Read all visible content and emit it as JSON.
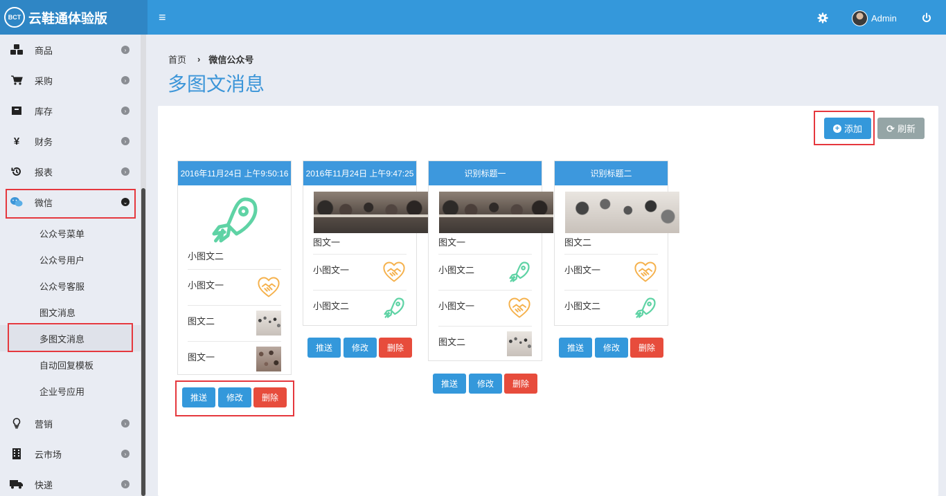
{
  "app": {
    "logo_text": "BCT",
    "title": "云鞋通体验版",
    "user_name": "Admin"
  },
  "sidebar": {
    "items": [
      {
        "label": "商品",
        "icon": "cubes-icon"
      },
      {
        "label": "采购",
        "icon": "cart-icon"
      },
      {
        "label": "库存",
        "icon": "archive-icon"
      },
      {
        "label": "财务",
        "icon": "yen-icon"
      },
      {
        "label": "报表",
        "icon": "history-icon"
      },
      {
        "label": "微信",
        "icon": "wechat-icon"
      },
      {
        "label": "营销",
        "icon": "lightbulb-icon"
      },
      {
        "label": "云市场",
        "icon": "building-icon"
      },
      {
        "label": "快递",
        "icon": "truck-icon"
      }
    ],
    "wechat_sub": [
      "公众号菜单",
      "公众号用户",
      "公众号客服",
      "图文消息",
      "多图文消息",
      "自动回复模板",
      "企业号应用"
    ]
  },
  "breadcrumb": {
    "home": "首页",
    "current": "微信公众号"
  },
  "page_title": "多图文消息",
  "toolbar": {
    "add_label": "添加",
    "refresh_label": "刷新"
  },
  "actions": {
    "push": "推送",
    "edit": "修改",
    "delete": "删除"
  },
  "cards": [
    {
      "header": "2016年11月24日 上午9:50:16",
      "cover_title": "小图文二",
      "rows": [
        "小图文一",
        "图文二",
        "图文一"
      ]
    },
    {
      "header": "2016年11月24日 上午9:47:25",
      "cover_title": "图文一",
      "rows": [
        "小图文一",
        "小图文二"
      ]
    },
    {
      "header": "识别标题一",
      "cover_title": "图文一",
      "rows": [
        "小图文二",
        "小图文一",
        "图文二"
      ]
    },
    {
      "header": "识别标题二",
      "cover_title": "图文二",
      "rows": [
        "小图文一",
        "小图文二"
      ]
    }
  ],
  "colors": {
    "primary": "#3498db",
    "danger": "#e74c3c",
    "highlight": "#e5373d",
    "rocket": "#5fd3a5",
    "handshake": "#f5b14c"
  }
}
